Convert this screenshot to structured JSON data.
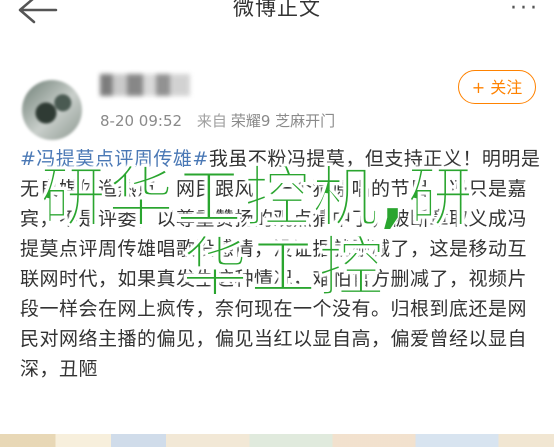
{
  "nav": {
    "title": "微博正文",
    "more_label": "···"
  },
  "post": {
    "meta": {
      "time": "8-20 09:52",
      "source_prefix": "来自",
      "source": "荣耀9 芝麻开门"
    },
    "follow_label": "+ 关注",
    "topic": "#冯提莫点评周传雄#",
    "text": "我虽不粉冯提莫，但支持正义！明明是无良媒体造热点，网民跟风，一个猜原唱的节目，冯只是嘉宾，不是评委，以尊重赞扬的观点猜中了，被断章取义成冯提莫点评周传雄唱歌没感情，没证据就删减了，这是移动互联网时代，如果真发生这种情况，难怕官方删减了，视频片段一样会在网上疯传，奈何现在一个没有。归根到底还是网民对网络主播的偏见，偏见当红以显自高，偏爱曾经以显自深，丑陋"
  },
  "watermark": {
    "line1": "研华工控机,研",
    "line2": "华工控"
  },
  "colors": {
    "accent": "#ff8200",
    "topic": "#4a78b5",
    "watermark": "#2aa52f"
  }
}
